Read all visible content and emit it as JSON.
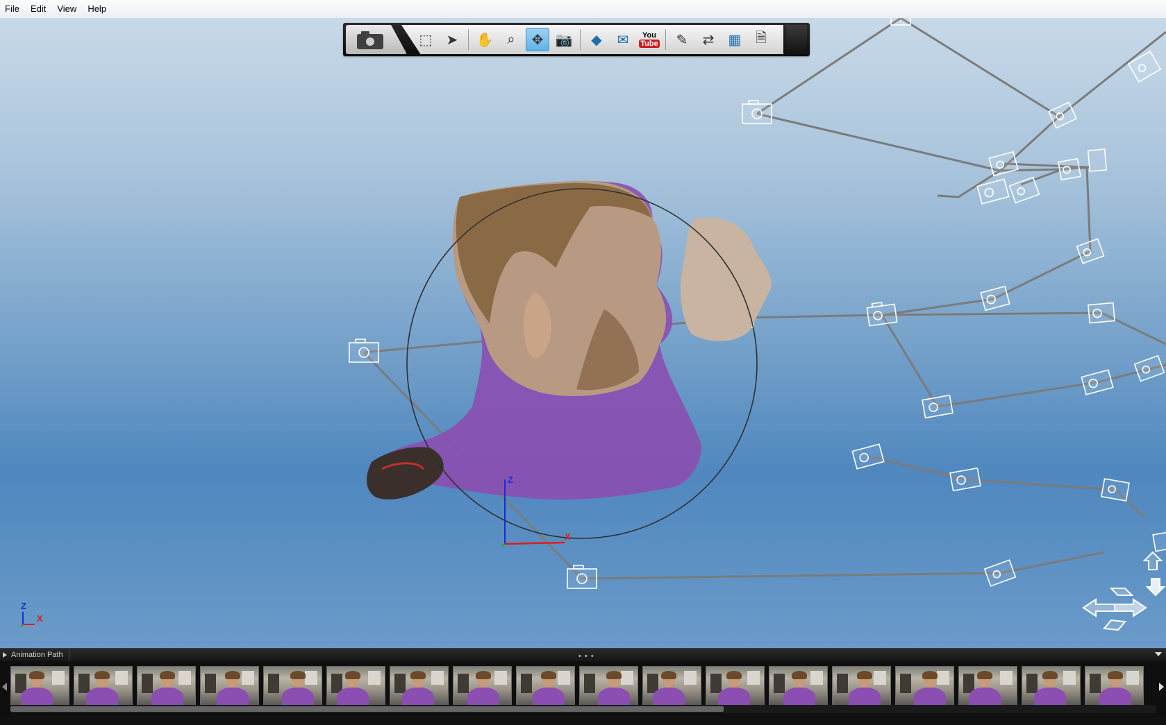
{
  "menu": {
    "items": [
      {
        "label": "File"
      },
      {
        "label": "Edit"
      },
      {
        "label": "View"
      },
      {
        "label": "Help"
      }
    ]
  },
  "toolbar": {
    "tools": [
      {
        "name": "select-rectangle-tool",
        "icon": "select-rect-icon"
      },
      {
        "name": "select-pointer-tool",
        "icon": "pointer-icon"
      },
      {
        "name": "pan-tool",
        "icon": "hand-icon"
      },
      {
        "name": "zoom-tool",
        "icon": "zoom-icon"
      },
      {
        "name": "orbit-tool",
        "icon": "orbit-icon",
        "active": true
      },
      {
        "name": "camera-lock-tool",
        "icon": "camera-lock-icon"
      },
      {
        "name": "measure-tool",
        "icon": "ruler-icon"
      },
      {
        "name": "email-tool",
        "icon": "envelope-icon"
      },
      {
        "name": "youtube-tool",
        "icon": "youtube-icon",
        "text_top": "You",
        "text_bottom": "Tube"
      },
      {
        "name": "eyedropper-tool",
        "icon": "eyedropper-icon"
      },
      {
        "name": "export-tool",
        "icon": "export-icon"
      },
      {
        "name": "download-mesh-tool",
        "icon": "mesh-download-icon"
      },
      {
        "name": "properties-tool",
        "icon": "document-icon"
      }
    ]
  },
  "viewport": {
    "gizmo_labels": {
      "z": "Z",
      "x": "X"
    },
    "corner_axis": {
      "z": "Z",
      "x": "X"
    }
  },
  "panel": {
    "title": "Animation Path",
    "grip": "• • •",
    "thumbnail_count": 18
  },
  "colors": {
    "axis_z": "#1b2bd6",
    "axis_x": "#e01b1b",
    "path_line": "#7b7b7b",
    "camera_wire": "#ffffff",
    "shirt": "#8b4fb1",
    "toolbar_active": "#5fb1e6"
  }
}
